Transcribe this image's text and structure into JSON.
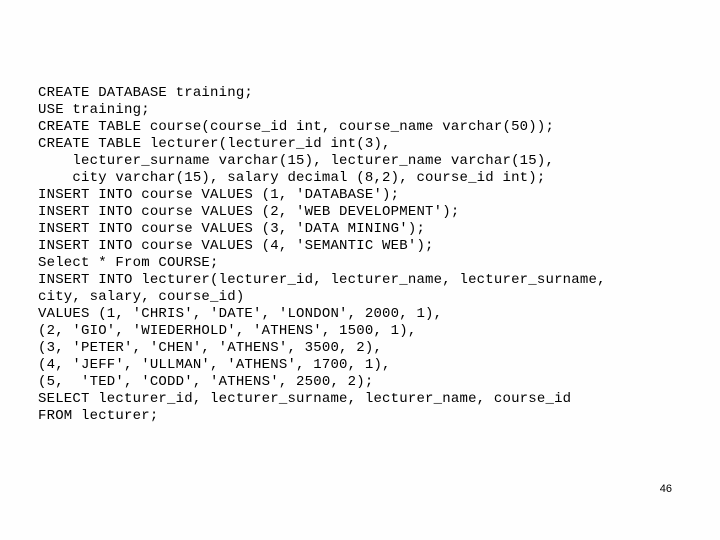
{
  "code": {
    "line0": "CREATE DATABASE training;",
    "line1": "USE training;",
    "line2": "CREATE TABLE course(course_id int, course_name varchar(50));",
    "line3": "CREATE TABLE lecturer(lecturer_id int(3),",
    "line4": "    lecturer_surname varchar(15), lecturer_name varchar(15),",
    "line5": "    city varchar(15), salary decimal (8,2), course_id int);",
    "line6": "INSERT INTO course VALUES (1, 'DATABASE');",
    "line7": "INSERT INTO course VALUES (2, 'WEB DEVELOPMENT');",
    "line8": "INSERT INTO course VALUES (3, 'DATA MINING');",
    "line9": "INSERT INTO course VALUES (4, 'SEMANTIC WEB');",
    "line10": "Select * From COURSE;",
    "line11": "INSERT INTO lecturer(lecturer_id, lecturer_name, lecturer_surname,",
    "line12": "city, salary, course_id)",
    "line13": "VALUES (1, 'CHRIS', 'DATE', 'LONDON', 2000, 1),",
    "line14": "(2, 'GIO', 'WIEDERHOLD', 'ATHENS', 1500, 1),",
    "line15": "(3, 'PETER', 'CHEN', 'ATHENS', 3500, 2),",
    "line16": "(4, 'JEFF', 'ULLMAN', 'ATHENS', 1700, 1),",
    "line17": "(5,  'TED', 'CODD', 'ATHENS', 2500, 2);",
    "line18": "SELECT lecturer_id, lecturer_surname, lecturer_name, course_id",
    "line19": "FROM lecturer;"
  },
  "page_number": "46"
}
